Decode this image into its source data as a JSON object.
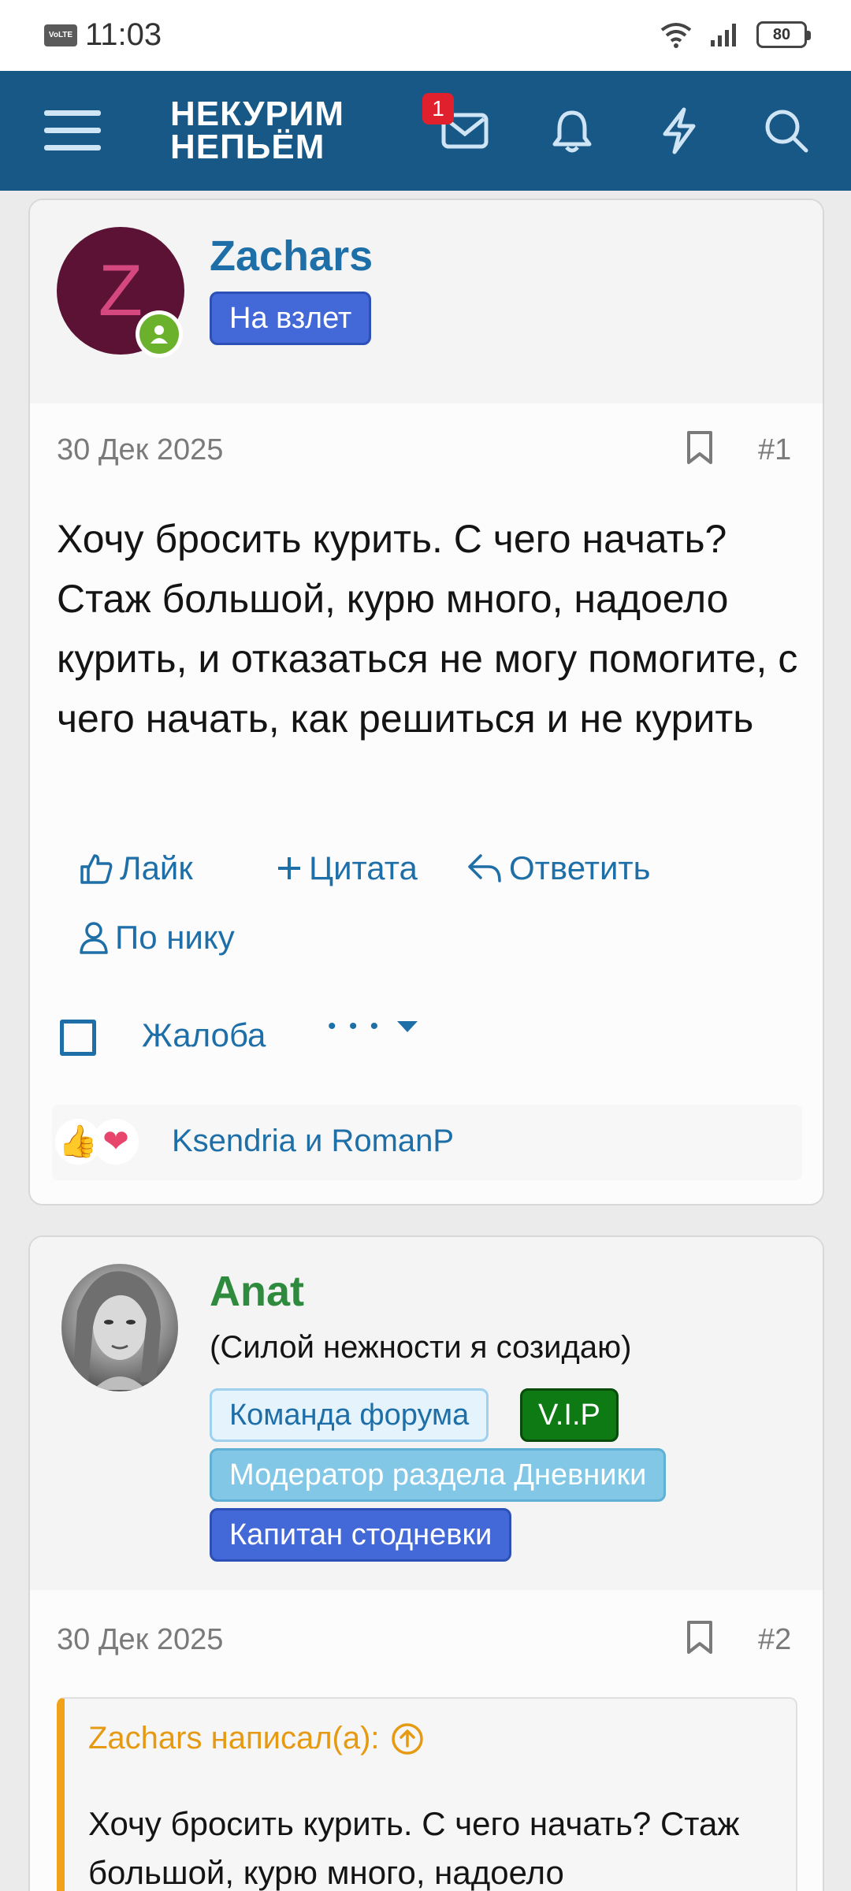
{
  "status_bar": {
    "network_badge": "VoLTE",
    "time": "11:03",
    "battery": "80"
  },
  "navbar": {
    "logo_line1": "НЕКУРИМ",
    "logo_line2": "НЕПЬЁМ",
    "inbox_badge": "1",
    "colors": {
      "background": "#185886",
      "badge": "#e0202c"
    }
  },
  "posts": [
    {
      "avatar_letter": "Z",
      "username": "Zachars",
      "username_color": "#1e6fa8",
      "tags": [
        "На взлет"
      ],
      "date": "30 Дек 2025",
      "number": "#1",
      "text": "Хочу бросить курить. С чего начать? Стаж большой, курю много, надоело курить, и отказаться не могу помогите, с чего начать, как решиться и не курить",
      "actions": {
        "like": "Лайк",
        "quote": "Цитата",
        "reply": "Ответить",
        "by_nick": "По нику",
        "report": "Жалоба",
        "more": "• • •"
      },
      "reactions": {
        "icons": [
          "thumbs-up-icon",
          "heart-icon"
        ],
        "names": "Ksendria и RomanP"
      }
    },
    {
      "username": "Anat",
      "username_color": "#2e8b3d",
      "user_title": "(Силой нежности я созидаю)",
      "tags": [
        "Команда форума",
        "V.I.P",
        "Модератор раздела Дневники",
        "Капитан стодневки"
      ],
      "date": "30 Дек 2025",
      "number": "#2",
      "quote": {
        "author": "Zachars написал(а):",
        "text": "Хочу бросить курить. С чего начать? Стаж большой, курю много, надоело"
      }
    }
  ]
}
